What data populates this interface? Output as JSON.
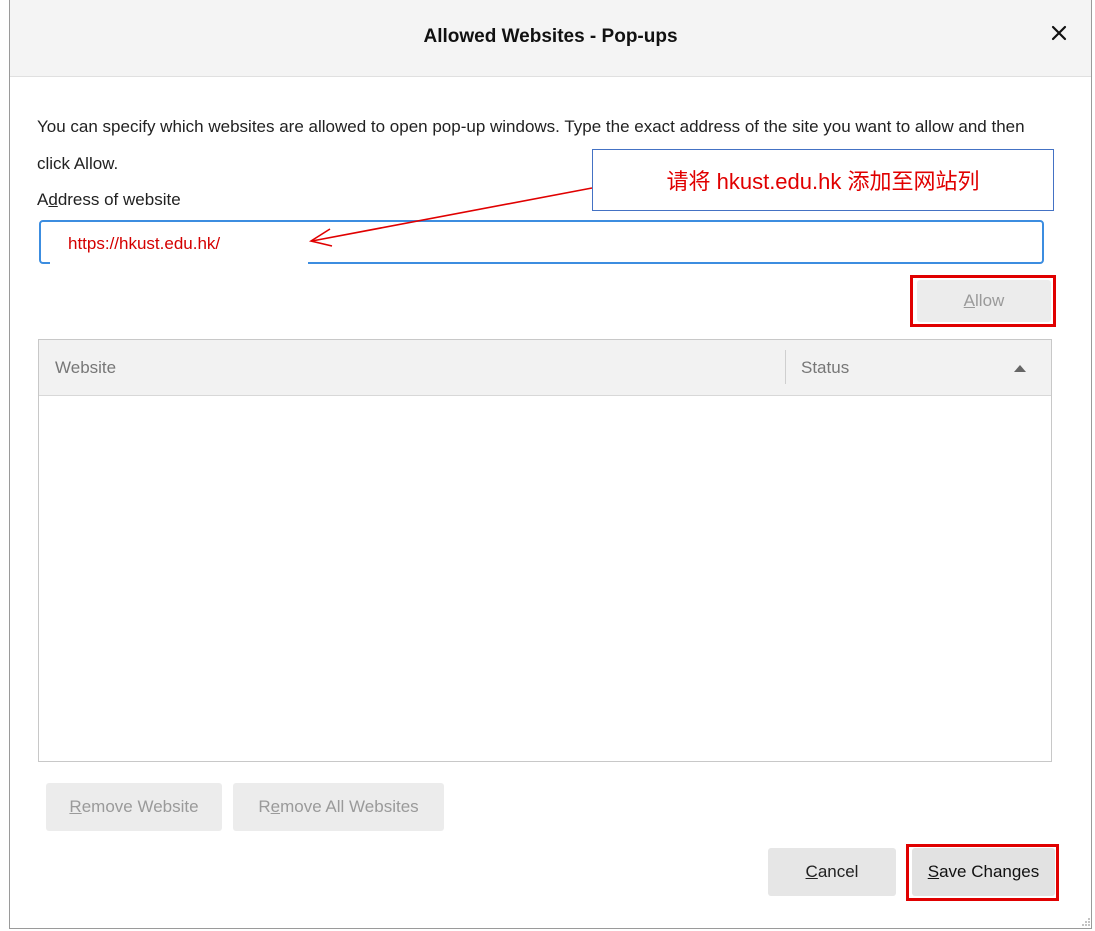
{
  "dialog": {
    "title": "Allowed Websites - Pop-ups",
    "close_glyph": "✕",
    "close_icon": "close-icon"
  },
  "description": "You can specify which websites are allowed to open pop-up windows. Type the exact address of the site you want to allow and then click Allow.",
  "address": {
    "label_before": "A",
    "label_accel": "d",
    "label_after": "dress of website",
    "value": "https://hkust.edu.hk/"
  },
  "annotation": {
    "callout_text": "请将 hkust.edu.hk 添加至网站列",
    "color": "#e00000"
  },
  "allow_button": {
    "accel": "A",
    "rest": "llow"
  },
  "table": {
    "columns": [
      "Website",
      "Status"
    ],
    "sort_icon": "sort-ascending-icon",
    "rows": []
  },
  "remove_website": {
    "accel": "R",
    "rest": "emove Website"
  },
  "remove_all": {
    "before": "R",
    "accel": "e",
    "rest": "move All Websites"
  },
  "cancel": {
    "accel": "C",
    "rest": "ancel"
  },
  "save": {
    "accel": "S",
    "rest": "ave Changes"
  },
  "colors": {
    "focus_border": "#3c8de0",
    "highlight_outline": "#e00000",
    "callout_border": "#4472c4"
  }
}
